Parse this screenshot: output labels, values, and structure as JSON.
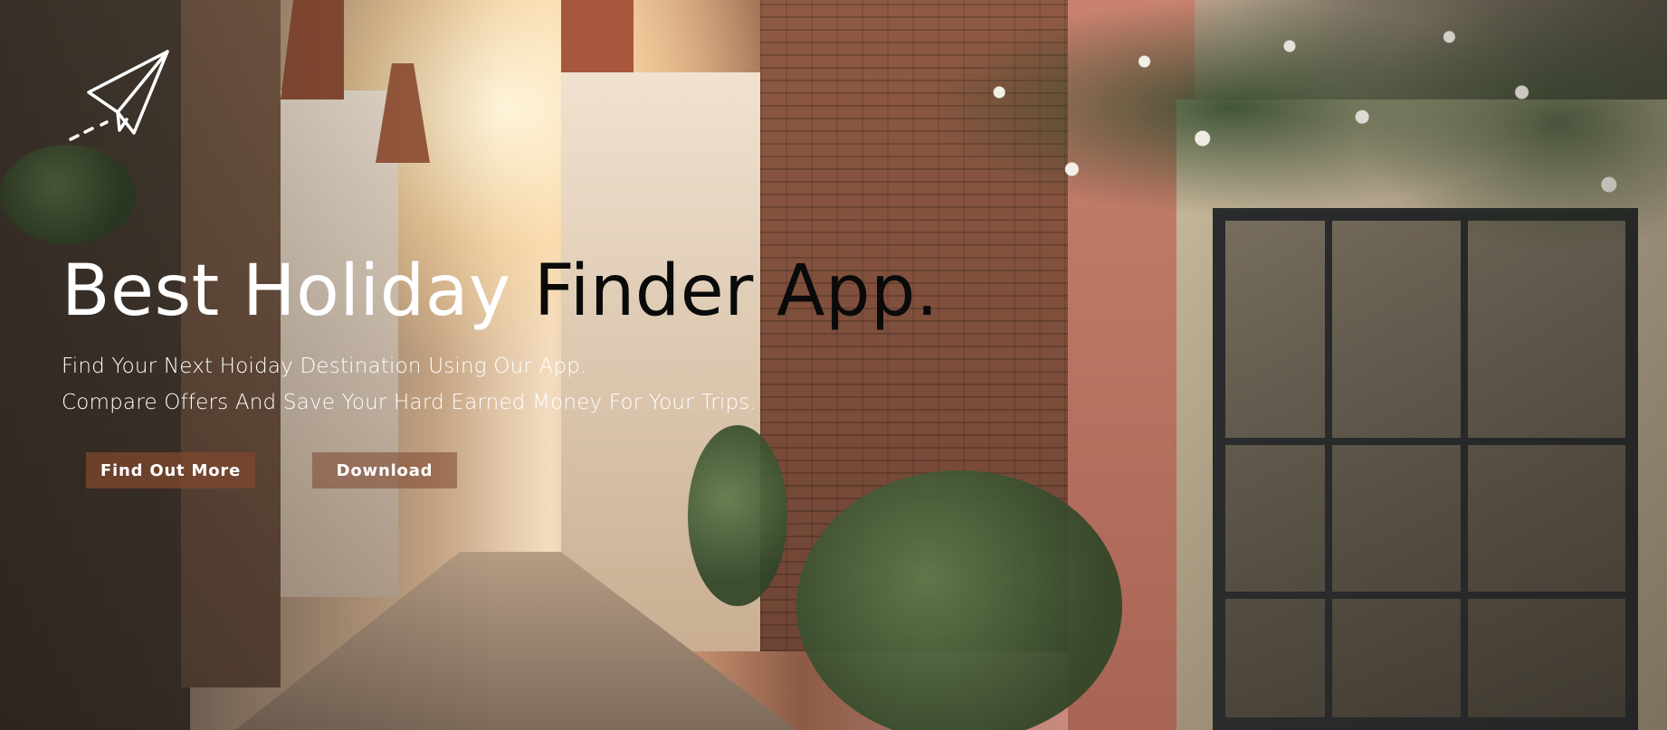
{
  "hero": {
    "headline_part1": "Best Holiday",
    "headline_part2": " Finder App.",
    "subtitle_line1": "Find Your Next Hoiday Destination Using Our App.",
    "subtitle_line2": "Compare Offers And Save Your Hard Earned Money For Your Trips.",
    "buttons": {
      "find_out_more": "Find Out More",
      "download": "Download"
    }
  },
  "logo": {
    "icon": "paper-plane-icon"
  },
  "colors": {
    "headline_light": "#ffffff",
    "headline_dark": "#0a0a0a",
    "button_bg": "#7d462e",
    "text": "#ffffff"
  }
}
